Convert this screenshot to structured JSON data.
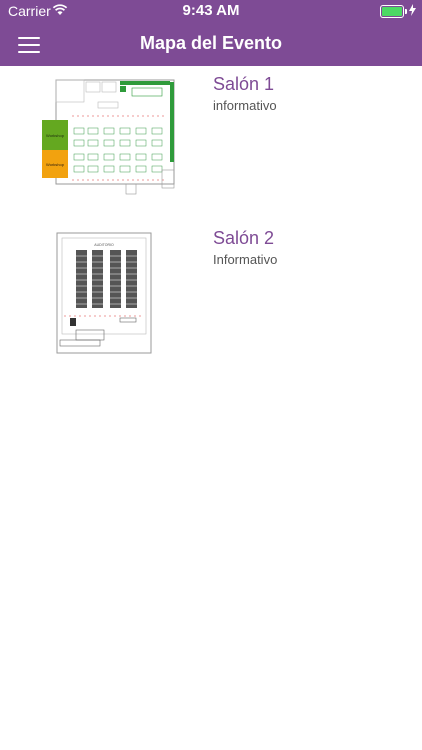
{
  "status_bar": {
    "carrier": "Carrier",
    "time": "9:43 AM"
  },
  "nav": {
    "title": "Mapa del Evento"
  },
  "colors": {
    "brand": "#7e4b95",
    "workshop_green": "#64a820",
    "workshop_orange": "#f2a20f"
  },
  "rooms": [
    {
      "name": "Salón 1",
      "description": "informativo",
      "map_labels": [
        "Workshop",
        "Workshop"
      ]
    },
    {
      "name": "Salón 2",
      "description": "Informativo",
      "map_labels": [
        "AUDITORIO"
      ]
    }
  ]
}
